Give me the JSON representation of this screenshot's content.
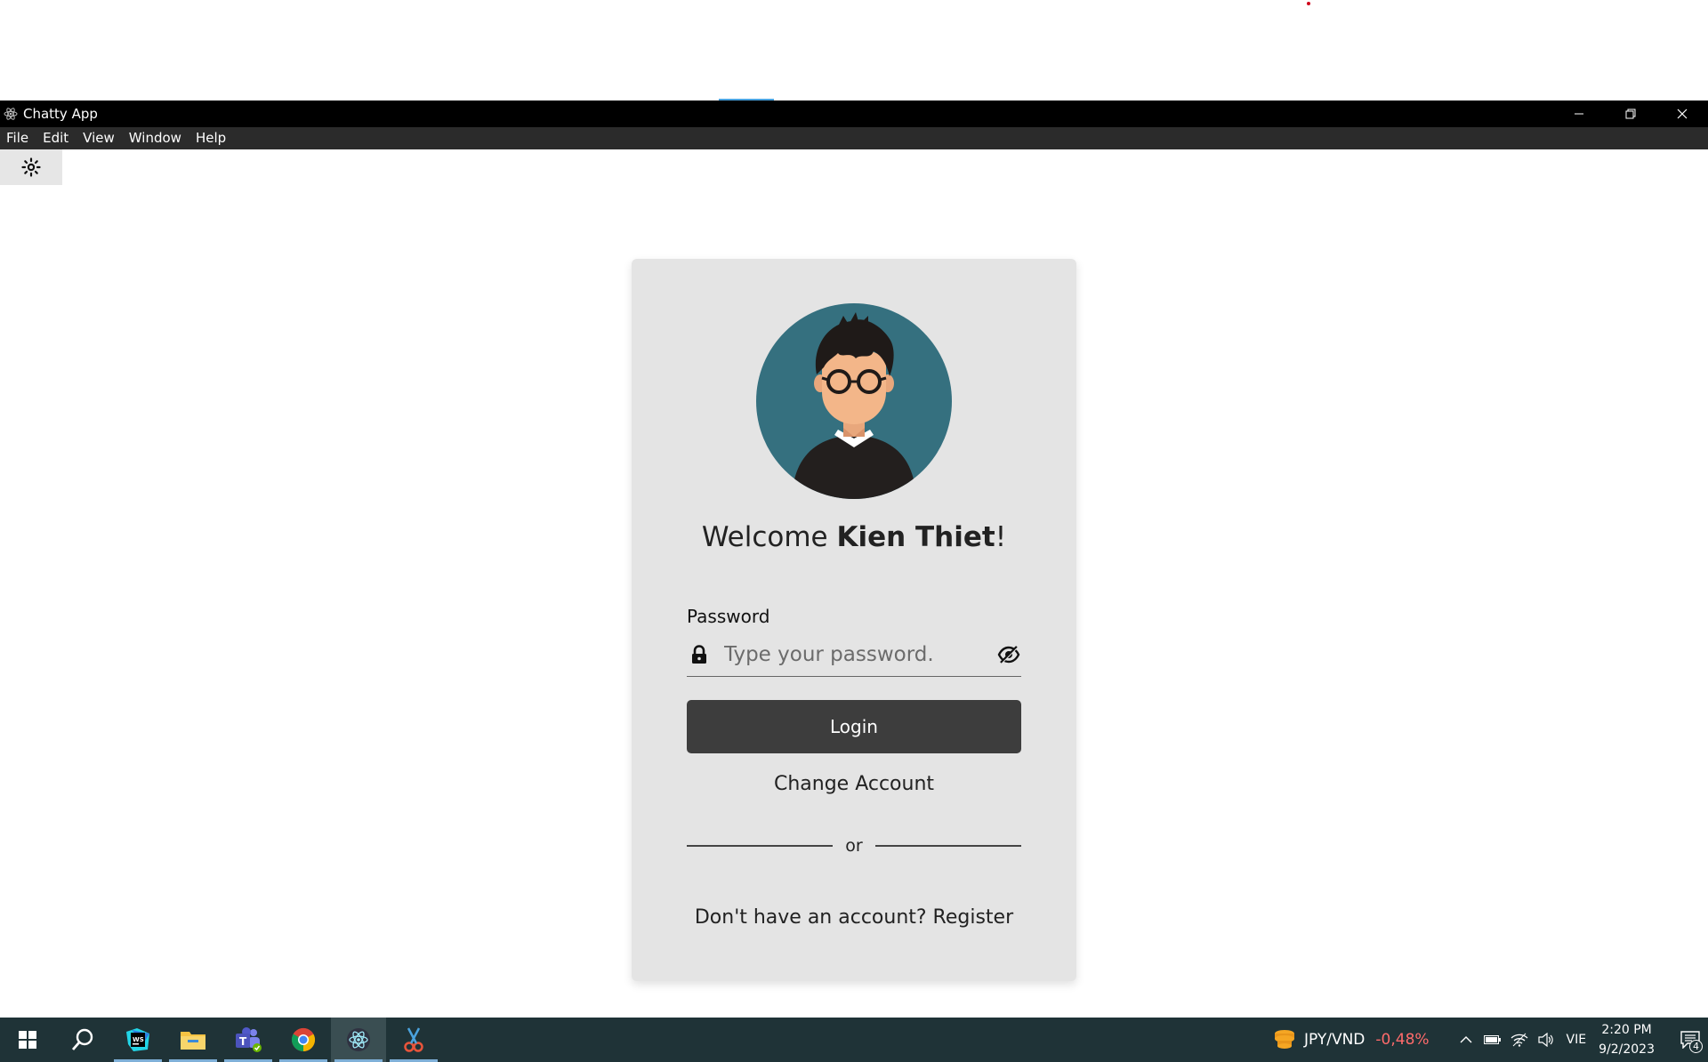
{
  "window": {
    "title": "Chatty App"
  },
  "menu": [
    {
      "label": "File"
    },
    {
      "label": "Edit"
    },
    {
      "label": "View"
    },
    {
      "label": "Window"
    },
    {
      "label": "Help"
    }
  ],
  "login": {
    "welcome_prefix": "Welcome ",
    "user_name": "Kien Thiet",
    "welcome_suffix": "!",
    "password_label": "Password",
    "password_placeholder": "Type your password.",
    "password_value": "",
    "login_button": "Login",
    "change_account": "Change Account",
    "divider_text": "or",
    "register_text": "Don't have an account? Register"
  },
  "taskbar": {
    "ticker_pair": "JPY/VND",
    "ticker_change": "-0,48%",
    "language": "VIE",
    "time": "2:20 PM",
    "date": "9/2/2023",
    "notification_count": "4"
  },
  "colors": {
    "titlebar": "#000000",
    "menubar": "#2b2b2b",
    "card": "#e4e4e4",
    "button": "#3d3d3d",
    "avatar_bg": "#35707f",
    "taskbar": "#1f3337",
    "ticker_negative": "#ff6b6b"
  },
  "icons": {
    "app": "electron-icon",
    "theme_toggle": "sun-icon",
    "password_prefix": "lock-icon",
    "password_toggle": "eye-slash-icon",
    "taskbar": [
      "windows-start-icon",
      "search-icon",
      "webstorm-icon",
      "file-explorer-icon",
      "teams-icon",
      "chrome-icon",
      "electron-icon",
      "snipping-tool-icon"
    ]
  }
}
